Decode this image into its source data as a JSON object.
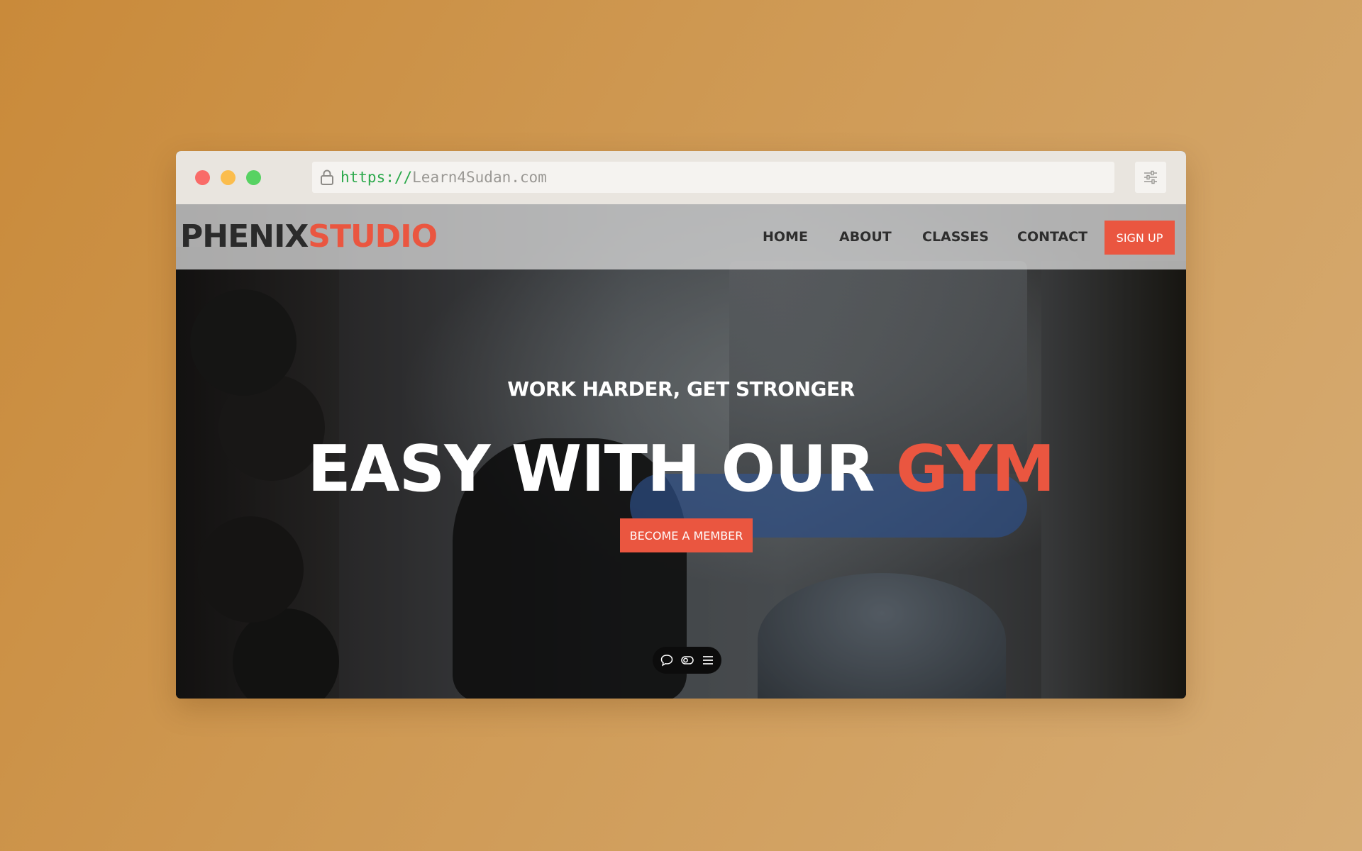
{
  "browser": {
    "url_scheme": "https://",
    "url_host": "Learn4Sudan.com"
  },
  "site": {
    "logo_part1": "PHENIX",
    "logo_part2": "STUDIO",
    "nav": [
      {
        "label": "HOME"
      },
      {
        "label": "ABOUT"
      },
      {
        "label": "CLASSES"
      },
      {
        "label": "CONTACT"
      }
    ],
    "signup_label": "SIGN UP"
  },
  "hero": {
    "subtitle": "WORK HARDER, GET STRONGER",
    "title_main": "EASY WITH OUR ",
    "title_accent": "GYM",
    "cta_label": "BECOME A MEMBER"
  },
  "toolbar": {
    "icons": [
      "comment-icon",
      "toggle-icon",
      "menu-icon"
    ]
  },
  "colors": {
    "accent": "#ea5640",
    "background_start": "#c98a3a",
    "background_end": "#d6ac74",
    "nav_text": "#2e2e2e",
    "url_scheme": "#2aa84a"
  }
}
